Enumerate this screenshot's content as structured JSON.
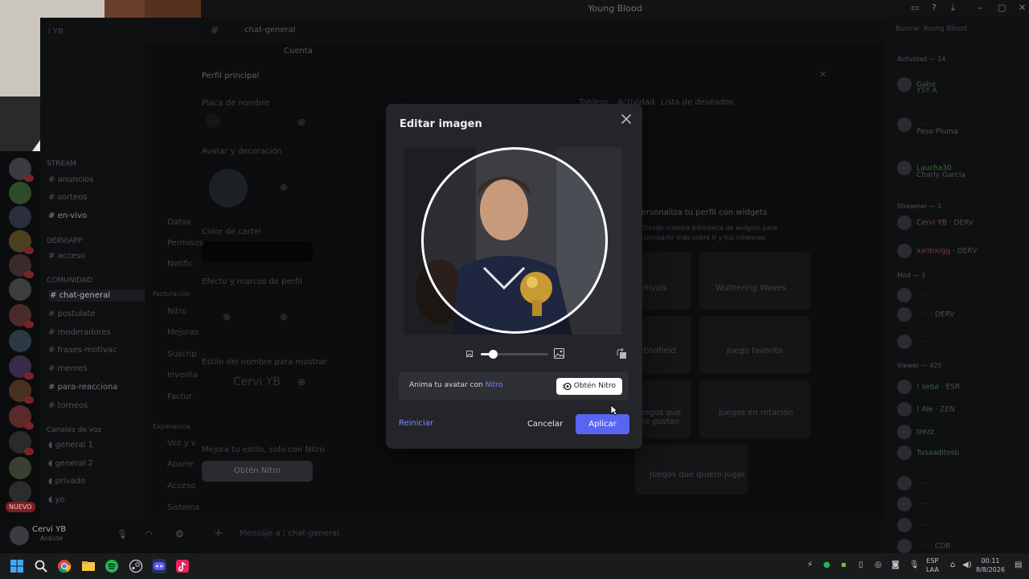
{
  "window": {
    "title": "Young Blood"
  },
  "chat": {
    "channel": "chat-general",
    "composer_placeholder": "Mensaje a ¦ chat-general",
    "search_placeholder": "Buscar Young Blood"
  },
  "sidebar": {
    "categories": [
      {
        "label": "STREAM",
        "channels": [
          "anuncios",
          "sorteos",
          "en-vivo"
        ]
      },
      {
        "label": "DERVIAPP",
        "channels": [
          "acceso"
        ]
      },
      {
        "label": "COMUNIDAD",
        "channels": [
          "chat-general",
          "postulate",
          "moderadores",
          "frases-motivac",
          "memes",
          "para-reacciona",
          "torneos"
        ]
      },
      {
        "label": "Canales de voz",
        "channels": [
          "general 1",
          "general 2",
          "privado",
          "yo"
        ]
      }
    ],
    "active_channel": "chat-general",
    "server_rail_new_badge": "NUEVO"
  },
  "user_panel": {
    "name": "Cervi YB",
    "status": "Ardiste"
  },
  "settings": {
    "tab_account": "Cuenta",
    "profile_select": "Perfil principal",
    "nameplate_label": "Placa de nombre",
    "avatar_label": "Avatar y decoración",
    "banner_label": "Color de cartel",
    "effects_label": "Efecto y marcos de perfil",
    "name_style_label": "Estilo del nombre para mostrar",
    "name_preview": "Cervi YB",
    "upsell_text": "Mejora tu estilo, solo con Nitro",
    "upsell_button": "Obtén Nitro",
    "profile_tabs": [
      "Tablero",
      "Actividad",
      "Lista de deseados"
    ],
    "widgets_title": "Personaliza tu perfil con widgets",
    "widgets_desc": "Desde nuestra biblioteca de widgets para compartir más sobre ti y tus intereses",
    "widget_cards": [
      "Rivals",
      "Wuthering Waves",
      "Endfield",
      "Juego favorito",
      "Juegos que me gustan",
      "Juegos en rotación",
      "Juegos que quiero jugar"
    ],
    "left_menu": [
      "Datos",
      "Permisos",
      "Notific",
      "Nitro",
      "Mejoras",
      "Suscrip",
      "Inventa",
      "Factur",
      "Voz y v",
      "Aparie",
      "Acceso",
      "Sistema"
    ],
    "left_menu_headers": [
      "Facturación",
      "Experiencia"
    ]
  },
  "members": {
    "activity_header": "Actividad — 24",
    "streamer_header": "Streamer — 2",
    "mod_header": "Mod — 3",
    "viewer_header": "Viewer — 425",
    "items": [
      "Gabo",
      "YSY A",
      "Peso Pluma",
      "Laucha30",
      "Charly García",
      "Cervi YB",
      "xanbx/gg",
      "! seba",
      "! Ale",
      "trezz",
      "Tusaaditosb"
    ],
    "tags": [
      "DERV",
      "DERV",
      "DERV",
      "ESR",
      "ZEN",
      "CDB"
    ]
  },
  "modal": {
    "title": "Editar imagen",
    "nitro_prompt": "Anima tu avatar con ",
    "nitro_word": "Nitro",
    "get_nitro_label": "Obtén Nitro",
    "reset_label": "Reiniciar",
    "cancel_label": "Cancelar",
    "apply_label": "Aplicar",
    "zoom_fraction": 0.18,
    "accent_color": "#5865f2"
  },
  "taskbar": {
    "lang": "ESP",
    "layout": "LAA",
    "time": "00:11",
    "date": "8/8/2026"
  }
}
